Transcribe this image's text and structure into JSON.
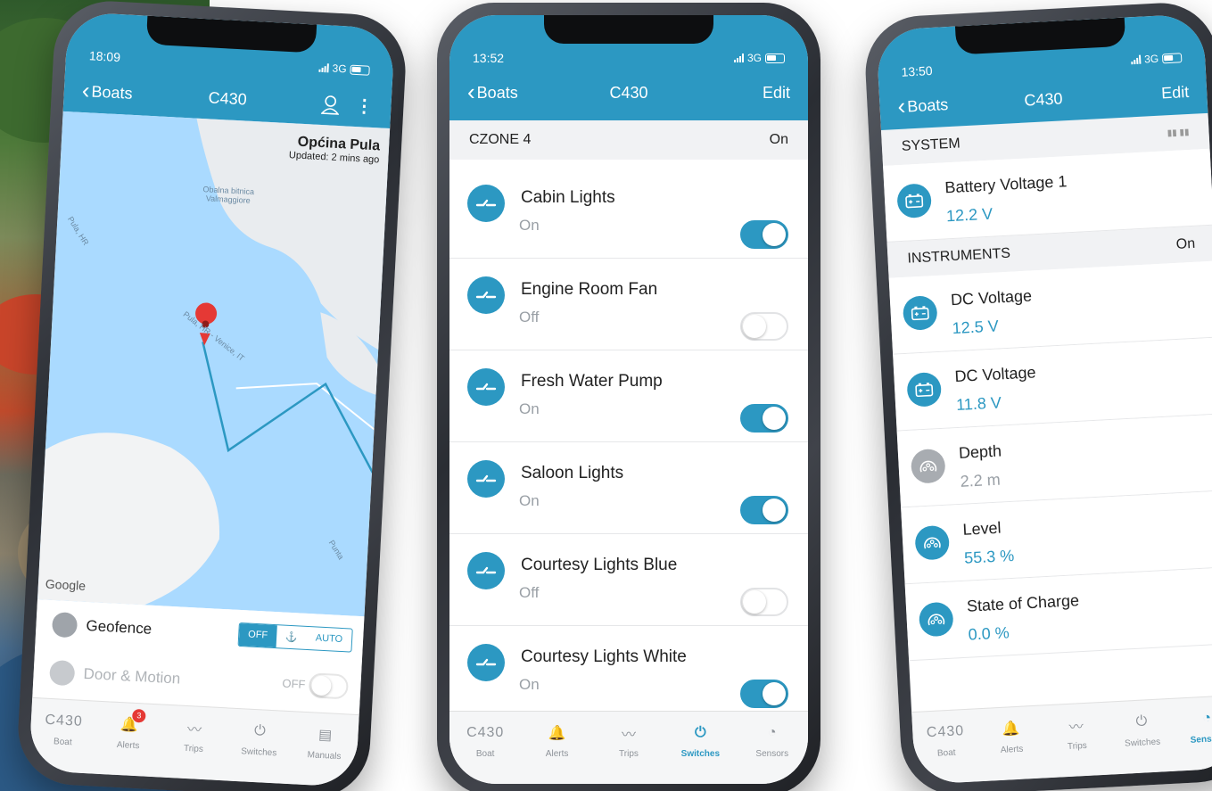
{
  "brand_color": "#2c98c2",
  "left_phone": {
    "status_time": "18:09",
    "network": "3G",
    "back_label": "Boats",
    "title": "C430",
    "map": {
      "location": "Općina Pula",
      "updated": "Updated: 2 mins ago",
      "labels": [
        "Obalna bitnica Valmaggiore",
        "Pula, HR",
        "Pula, HR - Venice, IT",
        "Punta"
      ],
      "provider": "Google"
    },
    "geofence": {
      "label": "Geofence",
      "options": [
        "OFF",
        "⚓",
        "AUTO"
      ],
      "selected": "OFF"
    },
    "door_motion": {
      "label": "Door & Motion",
      "state": "OFF"
    },
    "tabs": [
      {
        "label": "Boat",
        "icon": "boat-name",
        "top": "C430"
      },
      {
        "label": "Alerts",
        "icon": "bell-icon",
        "badge": "3"
      },
      {
        "label": "Trips",
        "icon": "trips-icon"
      },
      {
        "label": "Switches",
        "icon": "switches-icon"
      },
      {
        "label": "Manuals",
        "icon": "manuals-icon"
      }
    ]
  },
  "mid_phone": {
    "status_time": "13:52",
    "network": "3G",
    "back_label": "Boats",
    "title": "C430",
    "edit_label": "Edit",
    "section": {
      "name": "CZONE 4",
      "state": "On"
    },
    "switches": [
      {
        "name": "Cabin Lights",
        "state": "On",
        "on": true
      },
      {
        "name": "Engine Room Fan",
        "state": "Off",
        "on": false
      },
      {
        "name": "Fresh Water Pump",
        "state": "On",
        "on": true
      },
      {
        "name": "Saloon Lights",
        "state": "On",
        "on": true
      },
      {
        "name": "Courtesy Lights Blue",
        "state": "Off",
        "on": false
      },
      {
        "name": "Courtesy Lights White",
        "state": "On",
        "on": true
      }
    ],
    "tabs": [
      {
        "label": "Boat",
        "top": "C430"
      },
      {
        "label": "Alerts"
      },
      {
        "label": "Trips"
      },
      {
        "label": "Switches",
        "active": true
      },
      {
        "label": "Sensors"
      }
    ]
  },
  "right_phone": {
    "status_time": "13:50",
    "network": "3G",
    "back_label": "Boats",
    "title": "C430",
    "edit_label": "Edit",
    "system_section": {
      "name": "SYSTEM"
    },
    "instruments_section": {
      "name": "INSTRUMENTS",
      "state": "On"
    },
    "system": [
      {
        "name": "Battery Voltage 1",
        "value": "12.2 V"
      }
    ],
    "instruments": [
      {
        "name": "DC Voltage",
        "value": "12.5 V",
        "icon": "battery-icon"
      },
      {
        "name": "DC Voltage",
        "value": "11.8 V",
        "icon": "battery-icon"
      },
      {
        "name": "Depth",
        "value": "2.2 m",
        "icon": "gauge-icon",
        "muted": true
      },
      {
        "name": "Level",
        "value": "55.3 %",
        "icon": "gauge-icon"
      },
      {
        "name": "State of Charge",
        "value": "0.0 %",
        "icon": "gauge-icon"
      }
    ],
    "tabs": [
      {
        "label": "Boat",
        "top": "C430"
      },
      {
        "label": "Alerts"
      },
      {
        "label": "Trips"
      },
      {
        "label": "Switches"
      },
      {
        "label": "Sensors",
        "active": true
      }
    ]
  }
}
